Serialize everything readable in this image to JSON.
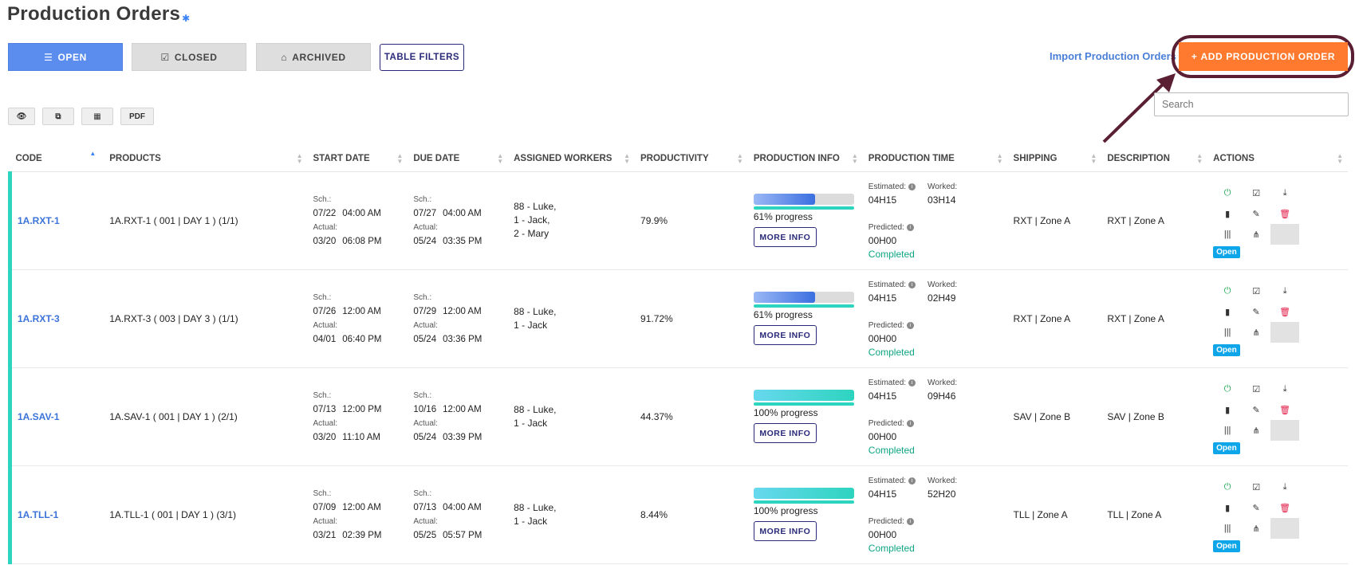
{
  "page": {
    "title": "Production Orders",
    "gear_icon": "gear-icon"
  },
  "tabs": {
    "open": "OPEN",
    "closed": "CLOSED",
    "archived": "ARCHIVED"
  },
  "table_filters": "TABLE FILTERS",
  "import_link": "Import Production Orders",
  "add_button": "ADD PRODUCTION ORDER",
  "search": {
    "placeholder": "Search"
  },
  "mini_toolbar": {
    "pdf": "PDF"
  },
  "columns": [
    "CODE",
    "PRODUCTS",
    "START DATE",
    "DUE DATE",
    "ASSIGNED WORKERS",
    "PRODUCTIVITY",
    "PRODUCTION INFO",
    "PRODUCTION TIME",
    "SHIPPING",
    "DESCRIPTION",
    "ACTIONS"
  ],
  "labels": {
    "sch": "Sch.:",
    "actual": "Actual:",
    "estimated": "Estimated:",
    "worked": "Worked:",
    "predicted": "Predicted:",
    "more_info": "MORE INFO",
    "open_badge": "Open"
  },
  "colors": {
    "accent_blue": "#5b8def",
    "orange": "#ff7a2e",
    "teal": "#2dd4bf",
    "navy": "#2a2a7a",
    "completed": "#0ea584"
  },
  "rows": [
    {
      "code": "1A.RXT-1",
      "product": "1A.RXT-1 ( 001 | DAY 1 ) (1/1)",
      "start_sch_date": "07/22",
      "start_sch_time": "04:00 AM",
      "start_act_date": "03/20",
      "start_act_time": "06:08 PM",
      "due_sch_date": "07/27",
      "due_sch_time": "04:00 AM",
      "due_act_date": "05/24",
      "due_act_time": "03:35 PM",
      "workers": [
        "88 - Luke,",
        "1 - Jack,",
        "2 - Mary"
      ],
      "productivity": "79.9%",
      "progress_pct": 61,
      "progress_text": "61% progress",
      "estimated": "04H15",
      "worked": "03H14",
      "predicted": "00H00",
      "status": "Completed",
      "shipping": "RXT | Zone A",
      "description": "RXT | Zone A"
    },
    {
      "code": "1A.RXT-3",
      "product": "1A.RXT-3 ( 003 | DAY 3 ) (1/1)",
      "start_sch_date": "07/26",
      "start_sch_time": "12:00 AM",
      "start_act_date": "04/01",
      "start_act_time": "06:40 PM",
      "due_sch_date": "07/29",
      "due_sch_time": "12:00 AM",
      "due_act_date": "05/24",
      "due_act_time": "03:36 PM",
      "workers": [
        "88 - Luke,",
        "1 - Jack"
      ],
      "productivity": "91.72%",
      "progress_pct": 61,
      "progress_text": "61% progress",
      "estimated": "04H15",
      "worked": "02H49",
      "predicted": "00H00",
      "status": "Completed",
      "shipping": "RXT | Zone A",
      "description": "RXT | Zone A"
    },
    {
      "code": "1A.SAV-1",
      "product": "1A.SAV-1 ( 001 | DAY 1 ) (2/1)",
      "start_sch_date": "07/13",
      "start_sch_time": "12:00 PM",
      "start_act_date": "03/20",
      "start_act_time": "11:10 AM",
      "due_sch_date": "10/16",
      "due_sch_time": "12:00 AM",
      "due_act_date": "05/24",
      "due_act_time": "03:39 PM",
      "workers": [
        "88 - Luke,",
        "1 - Jack"
      ],
      "productivity": "44.37%",
      "progress_pct": 100,
      "progress_text": "100% progress",
      "estimated": "04H15",
      "worked": "09H46",
      "predicted": "00H00",
      "status": "Completed",
      "shipping": "SAV | Zone B",
      "description": "SAV | Zone B"
    },
    {
      "code": "1A.TLL-1",
      "product": "1A.TLL-1 ( 001 | DAY 1 ) (3/1)",
      "start_sch_date": "07/09",
      "start_sch_time": "12:00 AM",
      "start_act_date": "03/21",
      "start_act_time": "02:39 PM",
      "due_sch_date": "07/13",
      "due_sch_time": "04:00 AM",
      "due_act_date": "05/25",
      "due_act_time": "05:57 PM",
      "workers": [
        "88 - Luke,",
        "1 - Jack"
      ],
      "productivity": "8.44%",
      "progress_pct": 100,
      "progress_text": "100% progress",
      "estimated": "04H15",
      "worked": "52H20",
      "predicted": "00H00",
      "status": "Completed",
      "shipping": "TLL | Zone A",
      "description": "TLL | Zone A"
    }
  ]
}
